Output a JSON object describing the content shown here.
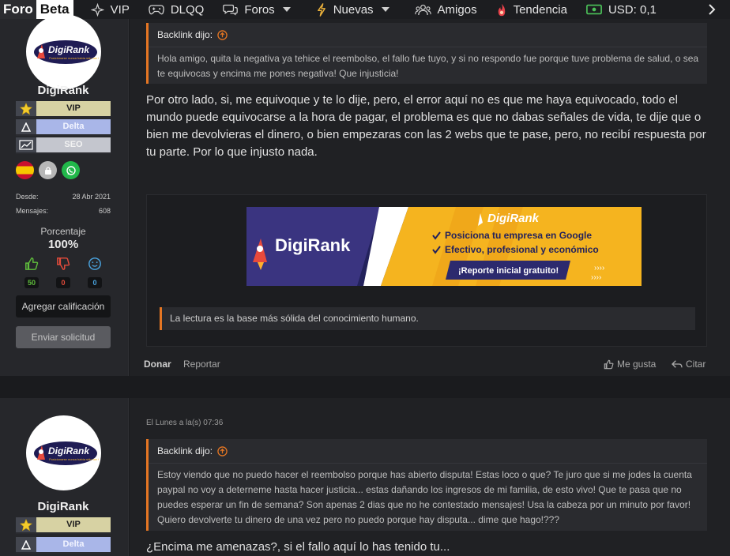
{
  "nav": {
    "logo_left": "Foro",
    "logo_right": "Beta",
    "items": [
      {
        "label": "VIP",
        "icon": "sparkle-icon"
      },
      {
        "label": "DLQQ",
        "icon": "gamepad-icon"
      },
      {
        "label": "Foros",
        "icon": "chat-icon"
      },
      {
        "label": "Nuevas",
        "icon": "bolt-icon"
      },
      {
        "label": "Amigos",
        "icon": "users-icon"
      },
      {
        "label": "Tendencia",
        "icon": "fire-icon"
      },
      {
        "label": "USD: 0,1",
        "icon": "money-icon"
      }
    ]
  },
  "colors": {
    "accent_orange": "#e57623",
    "vip": "#d7d2a3",
    "delta": "#a9b6e8",
    "seo": "#c4c6ce",
    "like_green": "#5fbd3c",
    "dislike_red": "#e34b3b",
    "neutral_blue": "#4aa4e0"
  },
  "post1": {
    "user": {
      "name": "DigiRank",
      "ranks": [
        {
          "label": "VIP",
          "icon": "star-icon"
        },
        {
          "label": "Delta",
          "icon": "delta-icon"
        },
        {
          "label": "SEO",
          "icon": "chart-icon"
        }
      ],
      "stats": [
        {
          "label": "Desde:",
          "value": "28 Abr 2021"
        },
        {
          "label": "Mensajes:",
          "value": "608"
        }
      ],
      "percent_label": "Porcentaje",
      "percent_value": "100%",
      "votes": {
        "positive": "50",
        "negative": "0",
        "neutral": "0"
      },
      "rate_button": "Agregar calificación",
      "request_button": "Enviar solicitud"
    },
    "quote_author": "Backlink dijo:",
    "quote_text": "Hola amigo, quita la negativa ya tehice el reembolso, el fallo fue tuyo, y si no respondo fue porque tuve problema de salud, o sea te equivocas y encima me pones negativa! Que injusticia!",
    "body": "Por otro lado, si, me equivoque y te lo dije, pero, el error aquí no es que me haya equivocado, todo el mundo puede equivocarse a la hora de pagar, el problema es que no dabas señales de vida, te dije que o bien me devolvieras el dinero, o bien empezaras con las 2 webs que te pase, pero, no recibí respuesta por tu parte. Por lo que injusto nada.",
    "banner": {
      "brand": "DigiRank",
      "line1": "Posiciona tu empresa en Google",
      "line2": "Efectivo, profesional y económico",
      "cta": "¡Reporte inicial gratuito!",
      "arrows": "››››"
    },
    "signature_quote": "La lectura es la base más sólida del conocimiento humano.",
    "actions": {
      "donate": "Donar",
      "report": "Reportar",
      "like": "Me gusta",
      "quote": "Citar"
    }
  },
  "post2": {
    "user": {
      "name": "DigiRank",
      "ranks": [
        {
          "label": "VIP",
          "icon": "star-icon"
        },
        {
          "label": "Delta",
          "icon": "delta-icon"
        }
      ]
    },
    "timestamp": "El Lunes a la(s) 07:36",
    "quote_author": "Backlink dijo:",
    "quote_text": "Estoy viendo que no puedo hacer el reembolso porque has abierto disputa! Estas loco o que? Te juro que si me jodes la cuenta paypal no voy a deterneme hasta hacer justicia... estas dañando los ingresos de mi familia, de esto vivo! Que te pasa que no puedes esperar un fin de semana? Son apenas 2 dias que no he contestado mensajes! Usa la cabeza por un minuto por favor! Quiero devolverte tu dinero de una vez pero no puedo porque hay disputa... dime que hago!???",
    "body": "¿Encima me amenazas?, si el fallo aquí lo has tenido tu..."
  }
}
